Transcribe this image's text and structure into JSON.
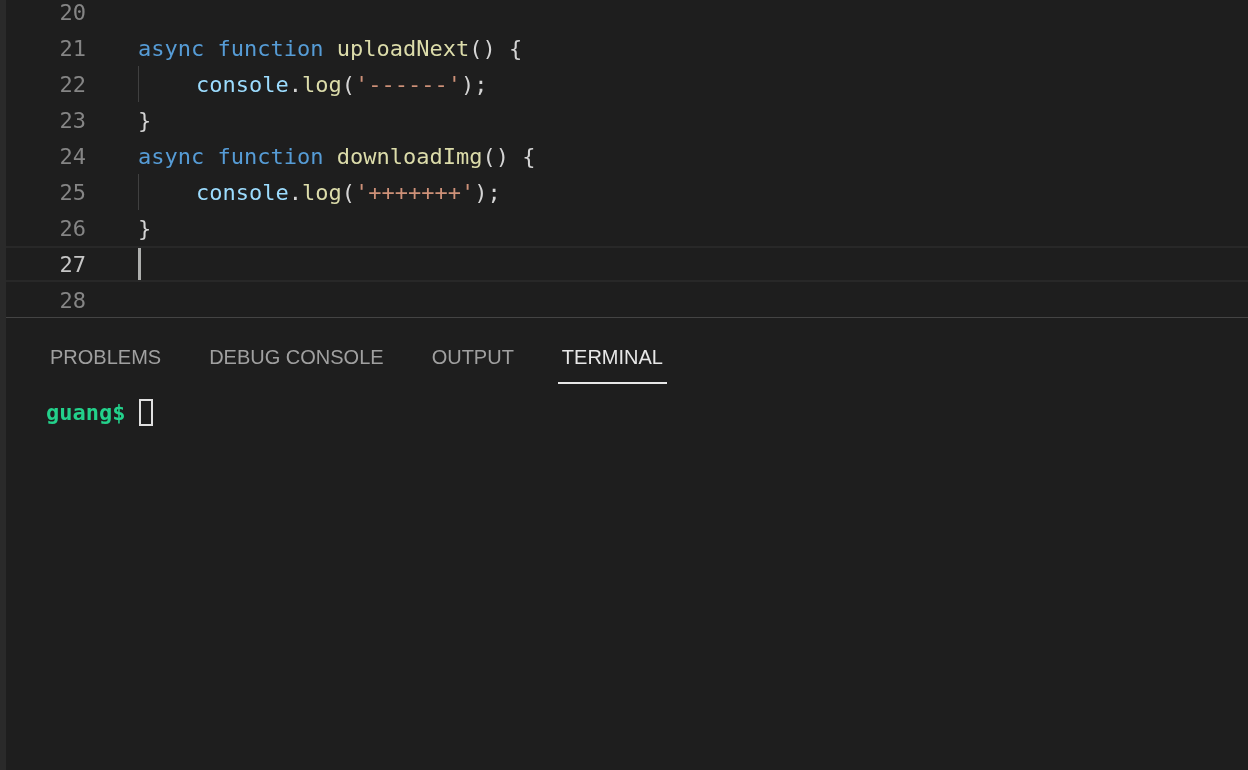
{
  "editor": {
    "lines": [
      {
        "number": "20",
        "current": false
      },
      {
        "number": "21",
        "current": false,
        "tokens": [
          {
            "kind": "keyword",
            "text": "async function"
          },
          {
            "kind": "function",
            "text": " uploadNext"
          },
          {
            "kind": "plain",
            "text": "() {"
          }
        ]
      },
      {
        "number": "22",
        "current": false,
        "indent_guide": true,
        "tokens": [
          {
            "kind": "variable",
            "text": "console"
          },
          {
            "kind": "plain",
            "text": "."
          },
          {
            "kind": "function",
            "text": "log"
          },
          {
            "kind": "plain",
            "text": "("
          },
          {
            "kind": "string",
            "text": "'------'"
          },
          {
            "kind": "plain",
            "text": ");"
          }
        ]
      },
      {
        "number": "23",
        "current": false,
        "tokens": [
          {
            "kind": "plain",
            "text": "}"
          }
        ]
      },
      {
        "number": "24",
        "current": false,
        "tokens": [
          {
            "kind": "keyword",
            "text": "async function"
          },
          {
            "kind": "function",
            "text": " downloadImg"
          },
          {
            "kind": "plain",
            "text": "() {"
          }
        ]
      },
      {
        "number": "25",
        "current": false,
        "indent_guide": true,
        "tokens": [
          {
            "kind": "variable",
            "text": "console"
          },
          {
            "kind": "plain",
            "text": "."
          },
          {
            "kind": "function",
            "text": "log"
          },
          {
            "kind": "plain",
            "text": "("
          },
          {
            "kind": "string",
            "text": "'+++++++'"
          },
          {
            "kind": "plain",
            "text": ");"
          }
        ]
      },
      {
        "number": "26",
        "current": false,
        "tokens": [
          {
            "kind": "plain",
            "text": "}"
          }
        ]
      },
      {
        "number": "27",
        "current": true
      },
      {
        "number": "28",
        "current": false
      }
    ]
  },
  "panel": {
    "tabs": [
      {
        "label": "PROBLEMS",
        "selected": false
      },
      {
        "label": "DEBUG CONSOLE",
        "selected": false
      },
      {
        "label": "OUTPUT",
        "selected": false
      },
      {
        "label": "TERMINAL",
        "selected": true
      }
    ],
    "terminal": {
      "prompt": "guang$"
    }
  }
}
